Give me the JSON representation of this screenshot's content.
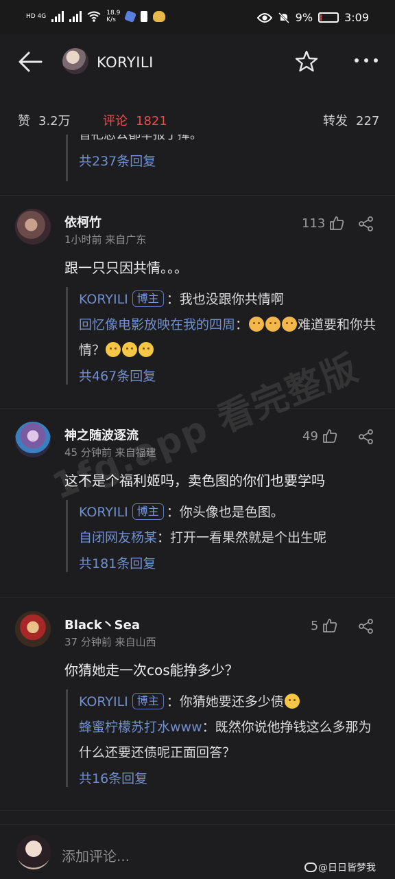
{
  "status_bar": {
    "network_left": "HD 4G",
    "speed": "18.9",
    "speed_unit": "K/s",
    "battery": "9%",
    "battery_level": 0.09,
    "time": "3:09"
  },
  "nav": {
    "title": "KORYILI"
  },
  "stats": {
    "likes_label": "赞",
    "likes_value": "3.2万",
    "comments_label": "评论",
    "comments_value": "1821",
    "reposts_label": "转发",
    "reposts_value": "227"
  },
  "clipped_previous": {
    "text": "皆祀忍公都举报丁撵。",
    "more_replies": "共237条回复"
  },
  "comments": [
    {
      "name": "依柯竹",
      "meta": "1小时前  来自广东",
      "likes": "113",
      "text": "跟一只只因共情。。。",
      "replies": [
        {
          "author": "KORYILI",
          "tag": "博主",
          "text": "：我也没跟你共情啊"
        },
        {
          "author": "回忆像电影放映在我的四周",
          "text": "：",
          "emoji_count": 3,
          "text_after": "难道要和你共情？",
          "emoji_after_count": 3
        }
      ],
      "more_replies": "共467条回复"
    },
    {
      "name": "神之随波逐流",
      "meta": "45 分钟前  来自福建",
      "likes": "49",
      "text": "这不是个福利姬吗，卖色图的你们也要学吗",
      "replies": [
        {
          "author": "KORYILI",
          "tag": "博主",
          "text": "：你头像也是色图。"
        },
        {
          "author": "自闭网友杨某",
          "text": "：打开一看果然就是个出生呢"
        }
      ],
      "more_replies": "共181条回复"
    },
    {
      "name": "Black丶Sea",
      "meta": "37 分钟前  来自山西",
      "likes": "5",
      "text": "你猜她走一次cos能挣多少？",
      "replies": [
        {
          "author": "KORYILI",
          "tag": "博主",
          "text": "：你猜她要还多少债"
        },
        {
          "author": "蜂蜜柠檬苏打水www",
          "text": "：既然你说他挣钱这么多那为什么还要还债呢正面回答？"
        }
      ],
      "more_replies": "共16条回复"
    }
  ],
  "watermark": "1fg.app 看完整版",
  "bottom": {
    "placeholder": "添加评论...",
    "source": "@日日皆梦我"
  },
  "colors": {
    "background": "#1d1d1f",
    "link_blue": "#6f8fcf",
    "accent_red": "#e94c4c"
  }
}
